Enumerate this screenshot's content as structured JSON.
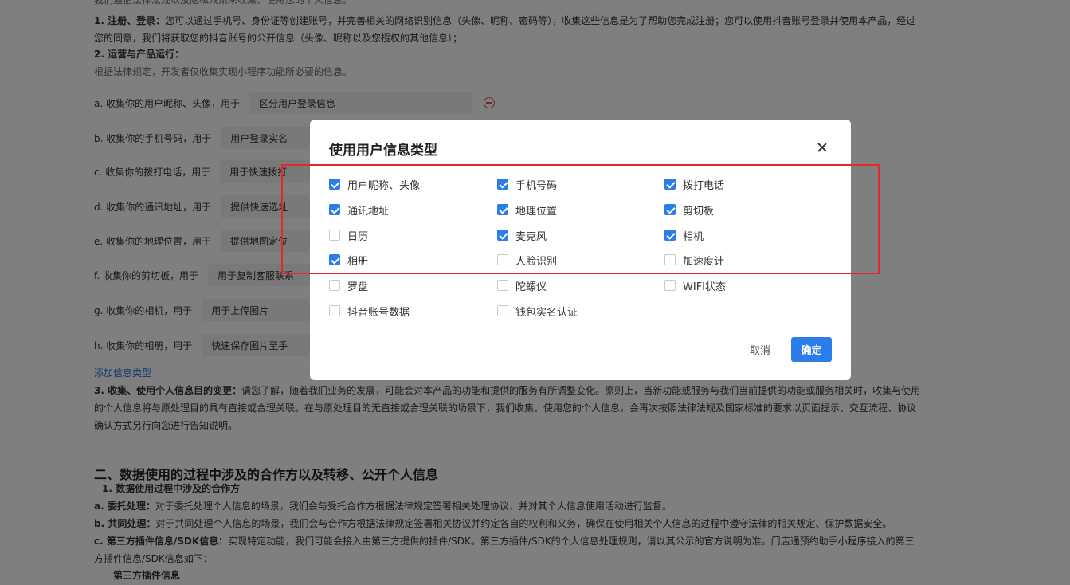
{
  "background": {
    "intro_top": "我们遵循法律法规以及隐私政策来收集、使用您的个人信息。",
    "section1_lead": "1. 注册、登录：",
    "section1_text": "您可以通过手机号、身份证等创建账号，并完善相关的网络识别信息（头像、昵称、密码等），收集这些信息是为了帮助您完成注册；您可以使用抖音账号登录并使用本产品，经过",
    "section1_text2": "您的同意，我们将获取您的抖音账号的公开信息（头像、昵称以及您授权的其他信息）；",
    "section2_lead": "2. 运营与产品运行：",
    "section2_text": "根据法律规定，开发者仅收集实现小程序功能所必要的信息。",
    "usage_rows": [
      {
        "label": "a. 收集你的用户昵称、头像，用于",
        "value": "区分用户登录信息"
      },
      {
        "label": "b. 收集你的手机号码，用于",
        "value": "用户登录实名"
      },
      {
        "label": "c. 收集你的拨打电话，用于",
        "value": "用于快速拨打"
      },
      {
        "label": "d. 收集你的通讯地址，用于",
        "value": "提供快速选址"
      },
      {
        "label": "e. 收集你的地理位置，用于",
        "value": "提供地图定位"
      },
      {
        "label": "f. 收集你的剪切板，用于",
        "value": "用于复制客服联系"
      },
      {
        "label": "g. 收集你的相机，用于",
        "value": "用于上传图片"
      },
      {
        "label": "h. 收集你的相册，用于",
        "value": "快速保存图片至手"
      }
    ],
    "add_info_link": "添加信息类型",
    "section3_lead": "3. 收集、使用个人信息目的变更：",
    "section3_text1": "请您了解，随着我们业务的发展，可能会对本产品的功能和提供的服务有所调整变化。原则上，当新功能或服务与我们当前提供的功能或服务相关时，收集与使用",
    "section3_text2": "的个人信息将与原处理目的具有直接或合理关联。在与原处理目的无直接或合理关联的场景下，我们收集、使用您的个人信息，会再次按照法律法规及国家标准的要求以页面提示、交互流程、协议",
    "section3_text3": "确认方式另行向您进行告知说明。",
    "heading2": "二、数据使用的过程中涉及的合作方以及转移、公开个人信息",
    "sub1": "1. 数据使用过程中涉及的合作方",
    "a_lead": "a. 委托处理：",
    "a_text": "对于委托处理个人信息的场景，我们会与受托合作方根据法律规定签署相关处理协议，并对其个人信息使用活动进行监督。",
    "b_lead": "b. 共同处理：",
    "b_text": "对于共同处理个人信息的场景，我们会与合作方根据法律规定签署相关协议并约定各自的权利和义务，确保在使用相关个人信息的过程中遵守法律的相关规定、保护数据安全。",
    "c_lead": "c. 第三方插件信息/SDK信息：",
    "c_text": "实现特定功能，我们可能会接入由第三方提供的插件/SDK。第三方插件/SDK的个人信息处理规则，请以其公示的官方说明为准。门店通预约助手小程序接入的第三",
    "c_text2": "方插件信息/SDK信息如下：",
    "plugin_heading": "第三方插件信息"
  },
  "dialog": {
    "title": "使用用户信息类型",
    "options": [
      {
        "label": "用户昵称、头像",
        "checked": true
      },
      {
        "label": "手机号码",
        "checked": true
      },
      {
        "label": "拨打电话",
        "checked": true
      },
      {
        "label": "通讯地址",
        "checked": true
      },
      {
        "label": "地理位置",
        "checked": true
      },
      {
        "label": "剪切板",
        "checked": true
      },
      {
        "label": "日历",
        "checked": false
      },
      {
        "label": "麦克风",
        "checked": true
      },
      {
        "label": "相机",
        "checked": true
      },
      {
        "label": "相册",
        "checked": true
      },
      {
        "label": "人脸识别",
        "checked": false
      },
      {
        "label": "加速度计",
        "checked": false
      },
      {
        "label": "罗盘",
        "checked": false
      },
      {
        "label": "陀螺仪",
        "checked": false
      },
      {
        "label": "WIFI状态",
        "checked": false
      },
      {
        "label": "抖音账号数据",
        "checked": false
      },
      {
        "label": "钱包实名认证",
        "checked": false
      }
    ],
    "cancel_label": "取消",
    "ok_label": "确定"
  },
  "colors": {
    "accent": "#2b7de9",
    "highlight": "#e0282e",
    "remove": "#e6505a",
    "link": "#1a6fd6"
  }
}
